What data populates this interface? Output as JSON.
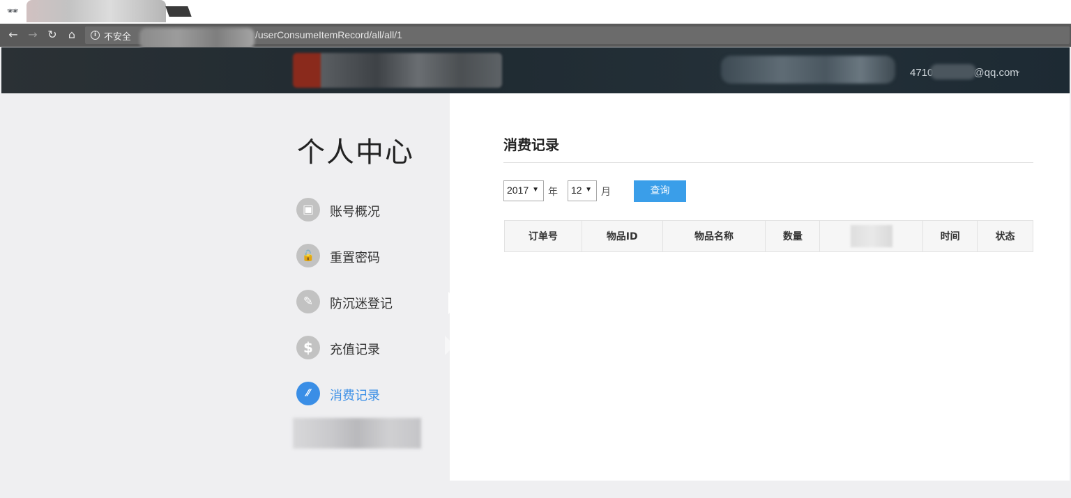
{
  "browser": {
    "tab_title": "",
    "incognito_icon": "incognito-icon",
    "security_label": "不安全",
    "url_path": "/userConsumeItemRecord/all/all/1"
  },
  "header": {
    "user_email_prefix": "4710",
    "user_email_suffix": "@qq.com",
    "caret": "⌄"
  },
  "sidebar": {
    "title": "个人中心",
    "items": [
      {
        "label": "账号概况",
        "icon": "monitor-icon",
        "glyph": "▣",
        "active": false
      },
      {
        "label": "重置密码",
        "icon": "lock-icon",
        "glyph": "🔓",
        "active": false
      },
      {
        "label": "防沉迷登记",
        "icon": "pen-icon",
        "glyph": "✎",
        "active": false
      },
      {
        "label": "充值记录",
        "icon": "dollar-icon",
        "glyph": "$",
        "active": false
      },
      {
        "label": "消费记录",
        "icon": "consume-icon",
        "glyph": "⁄⁄",
        "active": true
      }
    ]
  },
  "main": {
    "title": "消费记录",
    "filter": {
      "year_value": "2017",
      "year_unit": "年",
      "month_value": "12",
      "month_unit": "月",
      "query_label": "查询"
    },
    "table": {
      "columns": [
        "订单号",
        "物品ID",
        "物品名称",
        "数量",
        "",
        "时间",
        "状态"
      ]
    }
  },
  "colors": {
    "accent": "#3a9ee9",
    "active_text": "#3a8ee6",
    "header_bg": "#1f2a31",
    "sidebar_bg": "#efeff1"
  }
}
